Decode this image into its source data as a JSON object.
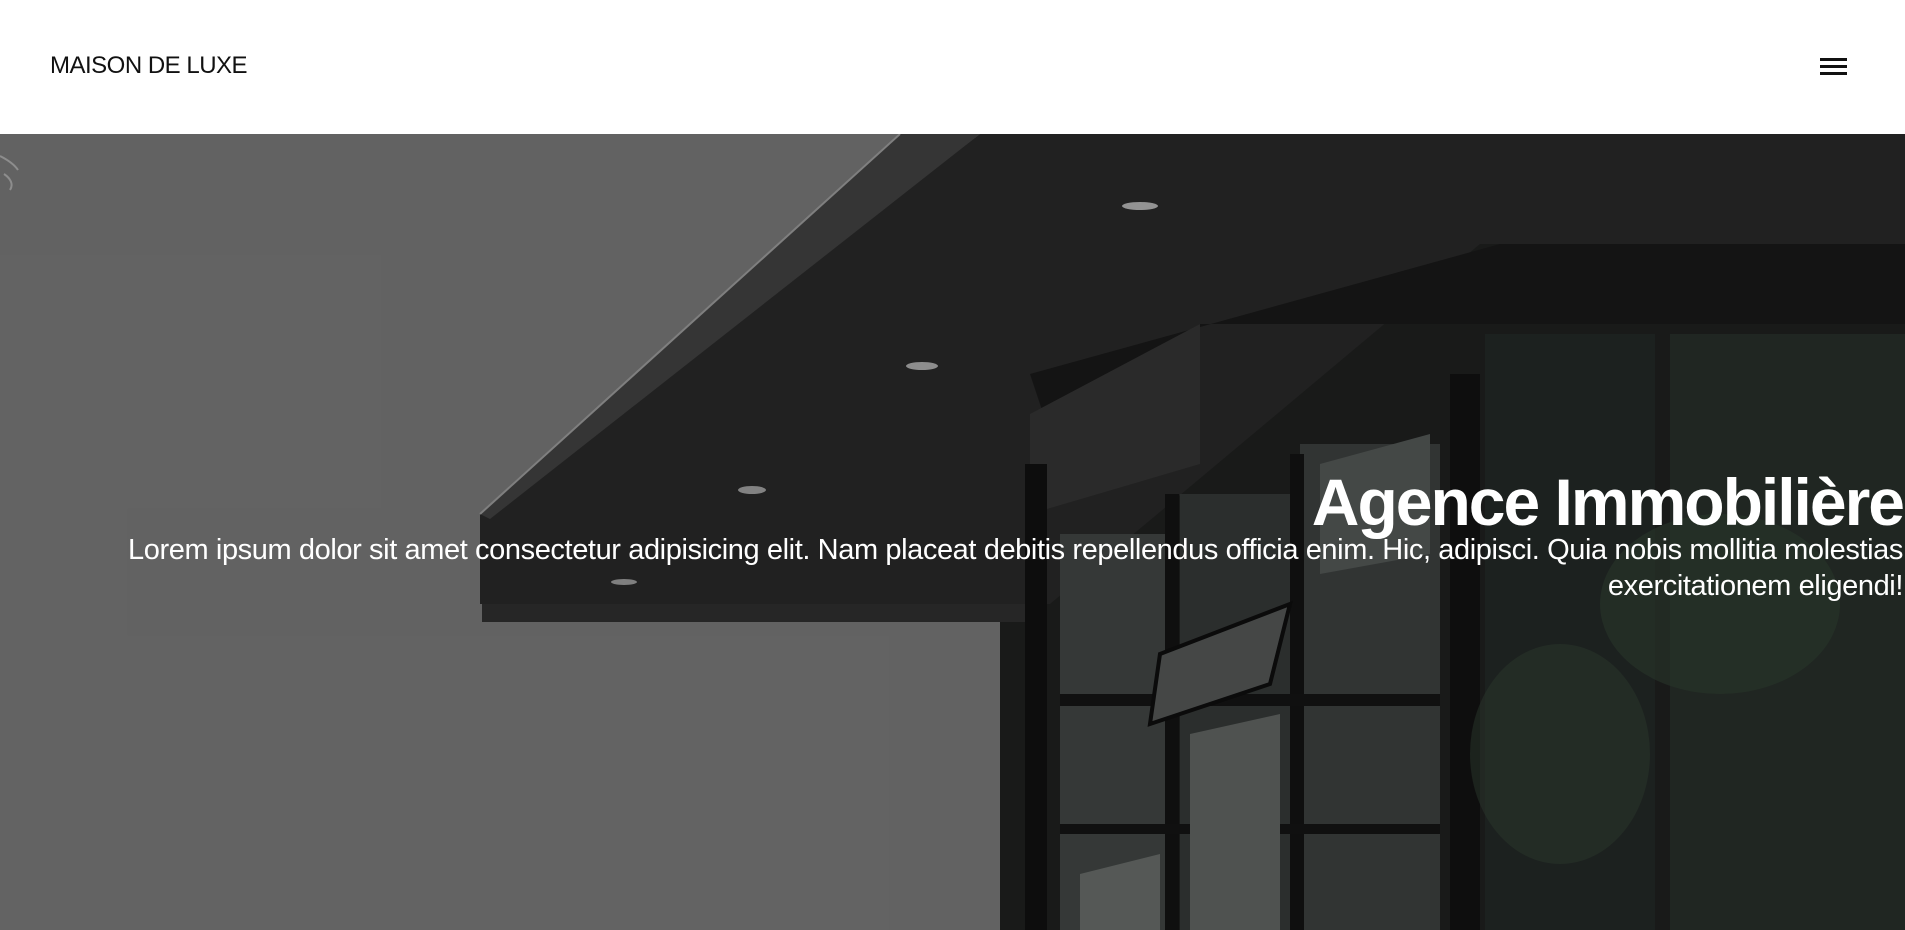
{
  "header": {
    "brand": "MAISON DE LUXE",
    "menu_icon": "hamburger-menu-icon"
  },
  "hero": {
    "title": "Agence Immobilière",
    "description": "Lorem ipsum dolor sit amet consectetur adipisicing elit. Nam placeat debitis repellendus officia enim. Hic, adipisci. Quia nobis mollitia molestias exercitationem eligendi!",
    "image": "modern-house-background-image"
  },
  "colors": {
    "header_background": "#ffffff",
    "text_dark": "#111111",
    "hero_sky": "#6c6c6c",
    "hero_text": "#ffffff"
  }
}
